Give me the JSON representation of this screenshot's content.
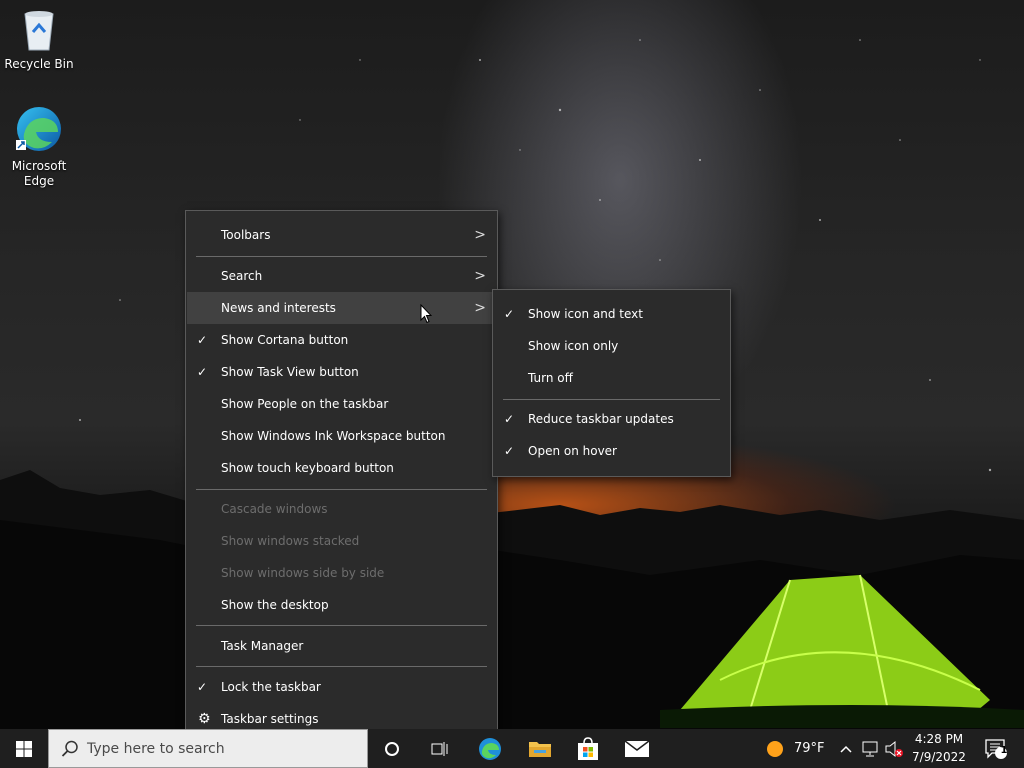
{
  "desktop": {
    "icons": [
      {
        "label": "Recycle Bin"
      },
      {
        "label_line1": "Microsoft",
        "label_line2": "Edge"
      }
    ]
  },
  "context_menu": {
    "items": [
      {
        "label": "Toolbars",
        "submenu": true
      },
      {
        "label": "Search",
        "submenu": true
      },
      {
        "label": "News and interests",
        "submenu": true,
        "hover": true
      },
      {
        "label": "Show Cortana button",
        "checked": true
      },
      {
        "label": "Show Task View button",
        "checked": true
      },
      {
        "label": "Show People on the taskbar"
      },
      {
        "label": "Show Windows Ink Workspace button"
      },
      {
        "label": "Show touch keyboard button"
      },
      {
        "label": "Cascade windows",
        "disabled": true
      },
      {
        "label": "Show windows stacked",
        "disabled": true
      },
      {
        "label": "Show windows side by side",
        "disabled": true
      },
      {
        "label": "Show the desktop"
      },
      {
        "label": "Task Manager"
      },
      {
        "label": "Lock the taskbar",
        "checked": true
      },
      {
        "label": "Taskbar settings",
        "icon": "gear-icon"
      }
    ]
  },
  "news_submenu": {
    "items": [
      {
        "label": "Show icon and text",
        "checked": true
      },
      {
        "label": "Show icon only"
      },
      {
        "label": "Turn off"
      },
      {
        "label": "Reduce taskbar updates",
        "checked": true
      },
      {
        "label": "Open on hover",
        "checked": true
      }
    ]
  },
  "taskbar": {
    "search_placeholder": "Type here to search",
    "weather": "79°F",
    "time": "4:28 PM",
    "date": "7/9/2022",
    "notification_count": "1"
  },
  "icons": {
    "check": "✓",
    "arrow": ">",
    "gear": "⚙"
  },
  "colors": {
    "menu_bg": "#2b2b2b",
    "menu_hover": "#414141",
    "disabled_text": "#6d6d6d",
    "taskbar_bg": "#1f1f1f",
    "tent_green": "#9be21a"
  }
}
